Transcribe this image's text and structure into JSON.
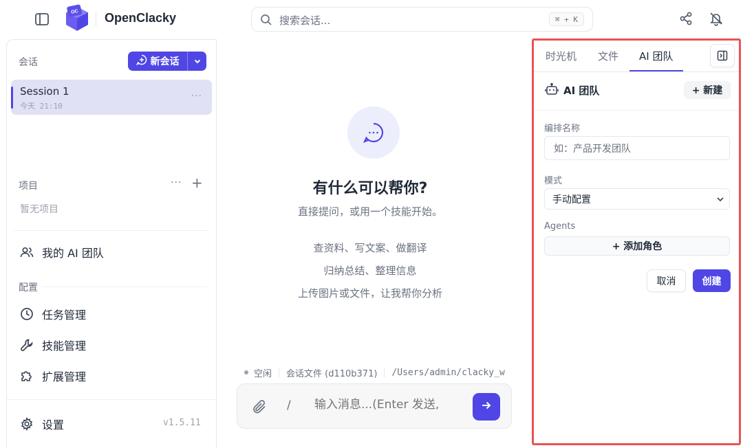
{
  "app": {
    "title": "OpenClacky",
    "logo_text": "OC"
  },
  "search": {
    "placeholder": "搜索会话...",
    "shortcut": "⌘ + K"
  },
  "icons": {
    "sidebar_toggle": "sidebar-toggle-icon",
    "share": "share-icon",
    "notifications": "bell-off-icon",
    "new_chat": "chat-plus-icon",
    "dropdown": "chevron-down-icon",
    "team": "users-icon",
    "tasks": "clock-icon",
    "skills": "wrench-icon",
    "extensions": "puzzle-icon",
    "settings": "gear-icon",
    "chat_bubble": "chat-bubble-icon",
    "attach": "paperclip-icon",
    "send": "arrow-right-icon",
    "bot": "robot-icon",
    "panel_toggle": "panel-right-icon"
  },
  "colors": {
    "accent": "#4f46e5",
    "highlight_border": "#e85353",
    "session_bg": "#e0e1f5"
  },
  "sidebar": {
    "sessions_label": "会话",
    "new_chat_label": "新会话",
    "sessions": [
      {
        "title": "Session 1",
        "time": "今天 21:10",
        "more": "···"
      }
    ],
    "projects_label": "项目",
    "projects_more": "···",
    "projects_add": "+",
    "projects_empty": "暂无项目",
    "my_team": "我的 AI 团队",
    "config_label": "配置",
    "config_items": [
      "任务管理",
      "技能管理",
      "扩展管理"
    ],
    "settings_label": "设置",
    "version": "v1.5.11"
  },
  "main": {
    "hero_title": "有什么可以帮你?",
    "hero_subtitle": "直接提问，或用一个技能开始。",
    "suggestions": [
      "查资料、写文案、做翻译",
      "归纳总结、整理信息",
      "上传图片或文件，让我帮你分析"
    ],
    "status": {
      "state": "空闲",
      "session_file": "会话文件 (d110b371)",
      "path": "/Users/admin/clacky_w"
    },
    "composer": {
      "slash": "/",
      "placeholder": "输入消息...(Enter 发送,"
    }
  },
  "right_panel": {
    "tabs": [
      "时光机",
      "文件",
      "AI 团队"
    ],
    "active_tab": "AI 团队",
    "header_title": "AI 团队",
    "new_label": "+ 新建",
    "name_label": "编排名称",
    "name_placeholder": "如：产品开发团队",
    "mode_label": "模式",
    "mode_value": "手动配置",
    "agents_label": "Agents",
    "add_role_label": "+ 添加角色",
    "cancel_label": "取消",
    "create_label": "创建"
  }
}
